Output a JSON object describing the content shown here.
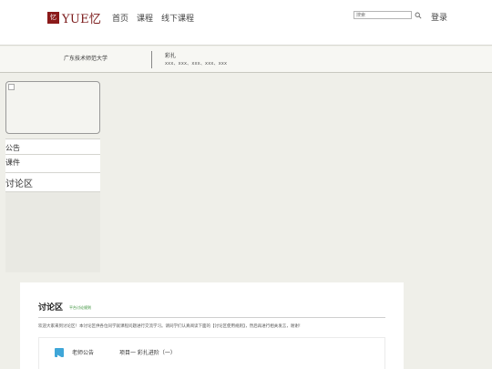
{
  "header": {
    "logo_mark": "忆",
    "logo_text": "YUE忆",
    "nav": [
      "首页",
      "课程",
      "线下课程"
    ],
    "search_placeholder": "搜索",
    "login": "登录"
  },
  "course_info": {
    "school": "广东技术师范大学",
    "course": "彩扎",
    "teachers": "xxx、xxx、xxx、xxx、xxx"
  },
  "sidebar": {
    "items": [
      "公告",
      "课件",
      "讨论区"
    ]
  },
  "discussion": {
    "title": "讨论区",
    "rules_link": "平台讨论规则",
    "notice": "欢迎大家来到讨论区！本讨论区供各位同学就课程问题进行交流学习。请同学们认真阅读下面的【讨论区使用规则】，然后再进行相关发言，谢谢！",
    "posts": [
      {
        "type": "老师公告",
        "title": "项目一 彩扎进阶（一）"
      }
    ]
  },
  "colors": {
    "brand": "#8b1a1a",
    "link_green": "#2e8b2e",
    "post_icon": "#3fa6d8"
  }
}
